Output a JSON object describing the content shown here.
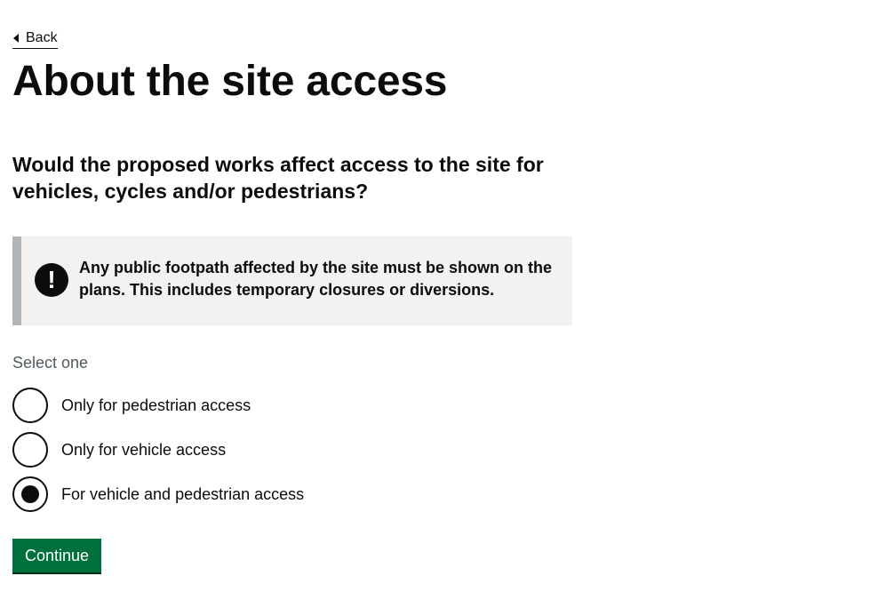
{
  "back_link": {
    "label": "Back"
  },
  "page_title": "About the site access",
  "question": "Would the proposed works affect access to the site for vehicles, cycles and/or pedestrians?",
  "warning": {
    "icon": "exclamation-icon",
    "symbol": "!",
    "text": "Any public footpath affected by the site must be shown on the plans. This includes temporary closures or diversions."
  },
  "hint": "Select one",
  "options": [
    {
      "label": "Only for pedestrian access",
      "checked": false
    },
    {
      "label": "Only for vehicle access",
      "checked": false
    },
    {
      "label": "For vehicle and pedestrian access",
      "checked": true
    }
  ],
  "continue_label": "Continue",
  "colors": {
    "text": "#0b0c0c",
    "hint": "#505a5f",
    "inset_bg": "#f3f2f1",
    "inset_border": "#b1b4b6",
    "button": "#00703c",
    "button_shadow": "#002d18"
  }
}
